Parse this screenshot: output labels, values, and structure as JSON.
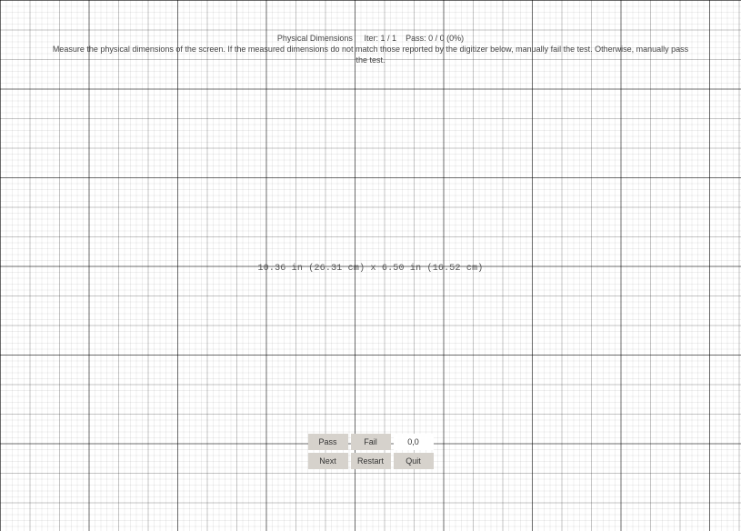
{
  "header": {
    "title": "Physical Dimensions",
    "iter_label": "Iter:",
    "iter_value": "1 / 1",
    "pass_label": "Pass:",
    "pass_value": "0 / 0 (0%)",
    "instructions": "Measure the physical dimensions of the screen. If the measured dimensions do not match those reported by the digitizer below, manually fail the test. Otherwise, manually pass the test."
  },
  "measurement": {
    "display_text": "10.36 in (26.31 cm) x 6.50 in (16.52 cm)"
  },
  "buttons": {
    "pass": "Pass",
    "fail": "Fail",
    "next": "Next",
    "restart": "Restart",
    "quit": "Quit"
  },
  "readout": {
    "value": "0,0"
  }
}
